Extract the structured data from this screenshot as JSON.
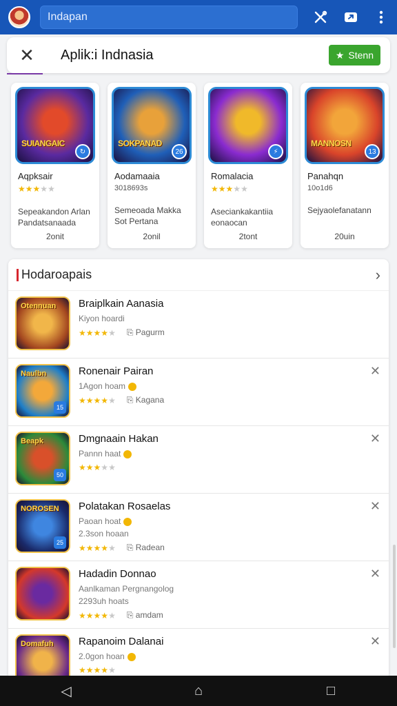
{
  "topbar": {
    "search_text": "Indapan",
    "icons": [
      "tools-icon",
      "share-icon",
      "more-vert-icon"
    ]
  },
  "dialog": {
    "title": "Aplik:i Indnasia",
    "open_label": "Stenn"
  },
  "featured": [
    {
      "art_label": "SUIANGAIC",
      "badge": "↻",
      "name": "Aqpksair",
      "sub_stars": 3,
      "sub": "",
      "desc": "Sepeakandon Arlan Pandatsanaada",
      "size": "2onit",
      "colors": [
        "#5a2aa0",
        "#e24a2a"
      ]
    },
    {
      "art_label": "SOKPANAD",
      "badge": "26",
      "name": "Aodamaaia",
      "sub_stars": 0,
      "sub": "3018693s",
      "desc": "Semeoada Makka Sot Pertana",
      "size": "2onil",
      "colors": [
        "#1f5fb8",
        "#e8a13a"
      ]
    },
    {
      "art_label": "",
      "badge": "⚡",
      "name": "Romalacia",
      "sub_stars": 3,
      "sub": "",
      "desc": "Aseciankakantiia eonaocan",
      "size": "2tont",
      "colors": [
        "#8a2bd0",
        "#f0b92a"
      ]
    },
    {
      "art_label": "MANNOSN",
      "badge": "13",
      "name": "Panahqn",
      "sub_stars": 0,
      "sub": "10o1d6",
      "desc": "Sejyaolefanatann",
      "size": "20uin",
      "colors": [
        "#d9442a",
        "#f2a53a"
      ]
    }
  ],
  "list": {
    "title": "Hodaroapais",
    "items": [
      {
        "icap": "Otennuan",
        "badge": "",
        "name": "Braiplkain Aanasia",
        "sub": "Kiyon hoardi",
        "sub2": "",
        "stars": 4,
        "meta_label": "Pagurm",
        "dot": false,
        "closable": false,
        "colors": [
          "#a3461f",
          "#f1b64a"
        ]
      },
      {
        "icap": "Naulbn",
        "badge": "15",
        "name": "Ronenair Pairan",
        "sub": "1Agon hoam",
        "sub2": "",
        "stars": 4,
        "meta_label": "Kagana",
        "dot": true,
        "closable": true,
        "colors": [
          "#1e7fc9",
          "#f3a83a"
        ]
      },
      {
        "icap": "Beapk",
        "badge": "50",
        "name": "Dmgnaain Hakan",
        "sub": "Pannn haat",
        "sub2": "",
        "stars": 3,
        "meta_label": "",
        "dot": true,
        "closable": true,
        "colors": [
          "#2c8a3a",
          "#d9502a"
        ]
      },
      {
        "icap": "NOROSEN",
        "badge": "25",
        "name": "Polatakan Rosaelas",
        "sub": "Paoan hoat",
        "sub2": "2.3son hoaan",
        "stars": 4,
        "meta_label": "Radean",
        "dot": true,
        "closable": true,
        "colors": [
          "#1a2a6a",
          "#3f86e0"
        ]
      },
      {
        "icap": "",
        "badge": "",
        "name": "Hadadin Donnao",
        "sub": "Aanlkaman Pergnangolog",
        "sub2": "2293uh hoats",
        "stars": 4,
        "meta_label": "amdam",
        "dot": false,
        "closable": true,
        "colors": [
          "#d4382a",
          "#6a2aa0"
        ]
      },
      {
        "icap": "Domafuh",
        "badge": "",
        "name": "Rapanoim Dalanai",
        "sub": "2.0gon hoan",
        "sub2": "",
        "stars": 4,
        "meta_label": "",
        "dot": true,
        "closable": true,
        "colors": [
          "#6a2a8a",
          "#f0b34a"
        ]
      }
    ]
  },
  "navbar": {
    "back_glyph": "◁",
    "home_glyph": "⌂",
    "recent_glyph": "□"
  }
}
